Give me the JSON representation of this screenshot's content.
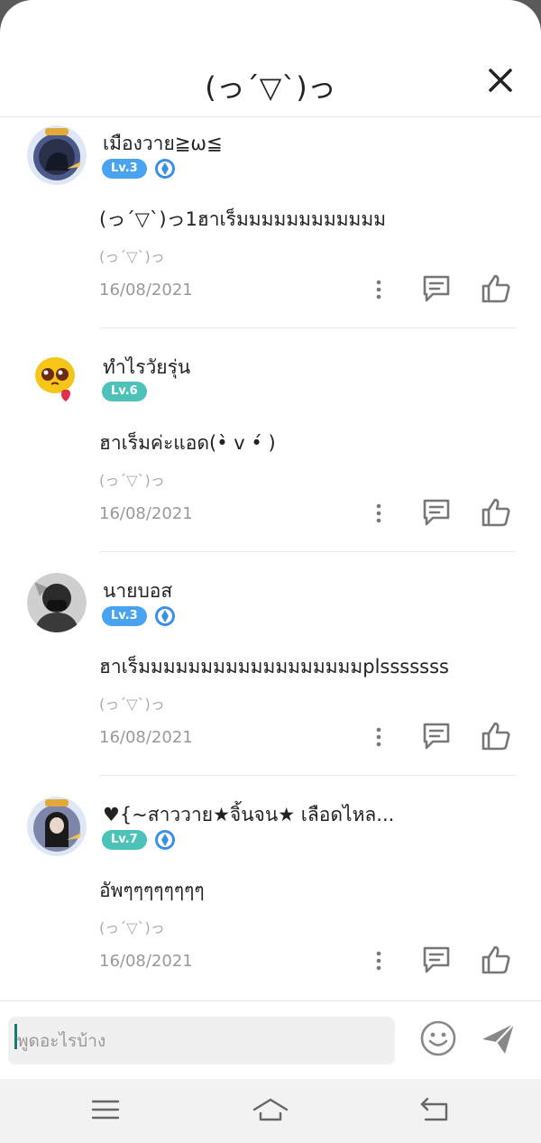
{
  "header": {
    "title": "(っ´▽`)っ"
  },
  "comments": [
    {
      "username": "เมืองวาย≧ω≦",
      "level": "Lv.3",
      "level_color": "#4aa3ef",
      "text": "(っ´▽`)っ1ฮาเร็มมมมมมมมมมมม",
      "sub": "(っ´▽`)っ",
      "date": "16/08/2021"
    },
    {
      "username": "ทำไรวัยรุ่น",
      "level": "Lv.6",
      "level_color": "#4dc2b8",
      "text": "ฮาเร็มค่ะแอด(•̀ v •́ )",
      "sub": "(っ´▽`)っ",
      "date": "16/08/2021"
    },
    {
      "username": "นายบอส",
      "level": "Lv.3",
      "level_color": "#4aa3ef",
      "text": "ฮาเร็มมมมมมมมมมมมมมมมมมplsssssss",
      "sub": "(っ´▽`)っ",
      "date": "16/08/2021"
    },
    {
      "username": "♥{~สาววาย★จิ้นจน★ เลือดไหล...",
      "level": "Lv.7",
      "level_color": "#4dc2b8",
      "text": "อัพๆๆๆๆๆๆๆๆ",
      "sub": "(っ´▽`)っ",
      "date": "16/08/2021"
    }
  ],
  "input": {
    "placeholder": "พูดอะไรบ้าง"
  },
  "icons": {
    "close": "close-icon",
    "more": "more-vertical-icon",
    "reply": "comment-icon",
    "like": "thumbs-up-icon",
    "emoji": "smiley-icon",
    "send": "send-icon",
    "menu": "menu-icon",
    "home": "home-icon",
    "back": "back-icon",
    "verified": "diamond-badge-icon"
  }
}
